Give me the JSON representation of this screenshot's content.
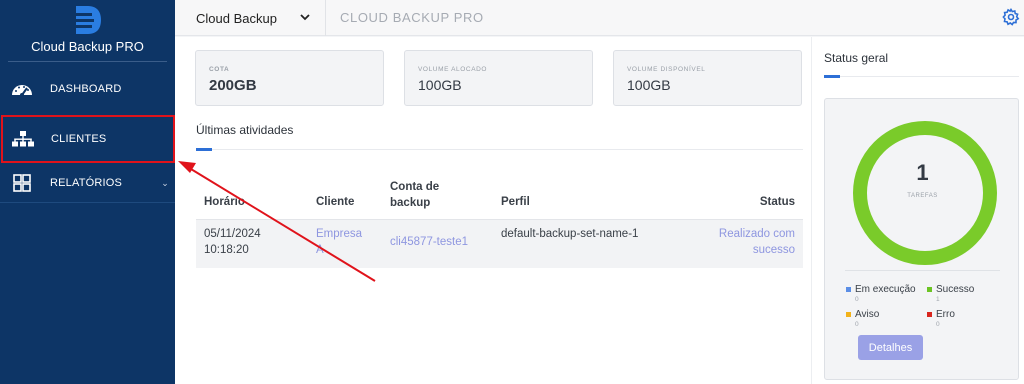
{
  "brand": {
    "name": "Cloud Backup PRO"
  },
  "sidebar": {
    "items": [
      {
        "label": "DASHBOARD"
      },
      {
        "label": "CLIENTES"
      },
      {
        "label": "RELATÓRIOS"
      }
    ]
  },
  "header": {
    "app_selector": "Cloud Backup",
    "title": "CLOUD BACKUP PRO"
  },
  "stats": [
    {
      "label": "COTA",
      "value": "200GB"
    },
    {
      "label": "VOLUME ALOCADO",
      "value": "100GB"
    },
    {
      "label": "VOLUME DISPONÍVEL",
      "value": "100GB"
    }
  ],
  "activities": {
    "tab": "Últimas atividades",
    "columns": [
      "Horário",
      "Cliente",
      "Conta de backup",
      "Perfil",
      "Status"
    ],
    "rows": [
      {
        "horario": "05/11/2024 10:18:20",
        "cliente": "Empresa A",
        "conta": "cli45877-teste1",
        "perfil": "default-backup-set-name-1",
        "status": "Realizado com sucesso"
      }
    ]
  },
  "status_geral": {
    "title": "Status geral",
    "total": "1",
    "total_label": "TAREFAS",
    "legend": [
      {
        "label": "Em execução",
        "count": "0",
        "color": "#5b8ee6"
      },
      {
        "label": "Sucesso",
        "count": "1",
        "color": "#6cc424"
      },
      {
        "label": "Aviso",
        "count": "0",
        "color": "#f2b21a"
      },
      {
        "label": "Erro",
        "count": "0",
        "color": "#d8261e"
      }
    ],
    "details_button": "Detalhes"
  },
  "colors": {
    "sidebar_bg": "#0d3566",
    "accent": "#2d6fd6",
    "donut": "#7acb2a",
    "link": "#8e96e0",
    "annotation": "#e0131b"
  }
}
